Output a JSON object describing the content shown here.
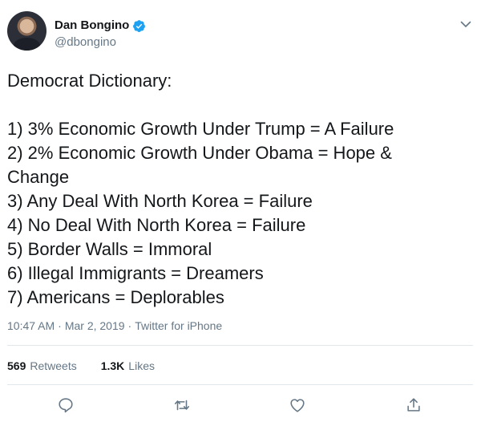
{
  "author": {
    "display_name": "Dan Bongino",
    "handle": "@dbongino",
    "verified_icon": "verified-badge-icon",
    "avatar_icon": "avatar"
  },
  "tweet": {
    "text": "Democrat Dictionary:\n\n1) 3% Economic Growth Under Trump = A Failure\n2) 2% Economic Growth Under Obama = Hope & Change\n3) Any Deal With North Korea = Failure\n4) No Deal With North Korea = Failure\n5) Border Walls = Immoral\n6) Illegal Immigrants = Dreamers\n7) Americans = Deplorables"
  },
  "meta": {
    "time": "10:47 AM",
    "separator": "·",
    "date": "Mar 2, 2019",
    "source": "Twitter for iPhone"
  },
  "stats": {
    "retweets_count": "569",
    "retweets_label": "Retweets",
    "likes_count": "1.3K",
    "likes_label": "Likes"
  },
  "actions": {
    "reply": "reply-icon",
    "retweet": "retweet-icon",
    "like": "heart-icon",
    "share": "share-icon"
  },
  "colors": {
    "text": "#14171a",
    "secondary": "#657786",
    "divider": "#e1e8ed",
    "verified": "#1da1f2"
  }
}
